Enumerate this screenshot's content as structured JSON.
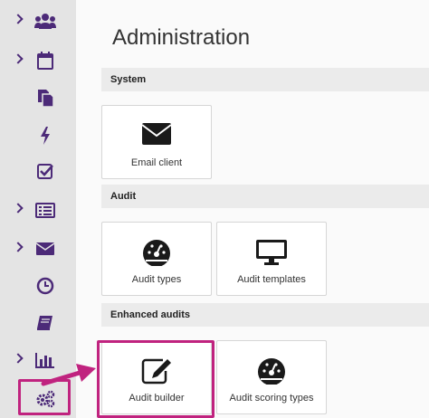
{
  "page_title": "Administration",
  "sidebar": {
    "items": [
      {
        "icon": "users-icon",
        "has_chevron": true
      },
      {
        "icon": "calendar-icon",
        "has_chevron": true
      },
      {
        "icon": "copy-icon",
        "has_chevron": false
      },
      {
        "icon": "bolt-icon",
        "has_chevron": false
      },
      {
        "icon": "check-square-icon",
        "has_chevron": false
      },
      {
        "icon": "list-icon",
        "has_chevron": true
      },
      {
        "icon": "envelope-icon",
        "has_chevron": true
      },
      {
        "icon": "clock-icon",
        "has_chevron": false
      },
      {
        "icon": "book-icon",
        "has_chevron": false
      },
      {
        "icon": "bar-chart-icon",
        "has_chevron": true
      },
      {
        "icon": "cogs-icon",
        "has_chevron": false,
        "highlighted": true
      }
    ]
  },
  "sections": [
    {
      "title": "System",
      "tiles": [
        {
          "label": "Email client",
          "icon": "envelope-icon"
        }
      ]
    },
    {
      "title": "Audit",
      "tiles": [
        {
          "label": "Audit types",
          "icon": "gauge-icon"
        },
        {
          "label": "Audit templates",
          "icon": "monitor-icon"
        }
      ]
    },
    {
      "title": "Enhanced audits",
      "tiles": [
        {
          "label": "Audit builder",
          "icon": "edit-icon",
          "highlighted": true
        },
        {
          "label": "Audit scoring types",
          "icon": "gauge-icon"
        }
      ]
    }
  ],
  "colors": {
    "sidebar_icon": "#4c2a78",
    "highlight": "#c0237f",
    "tile_icon": "#1a1a1a"
  }
}
